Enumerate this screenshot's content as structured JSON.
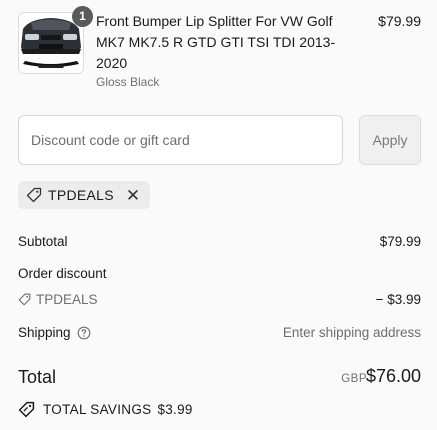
{
  "product": {
    "title": "Front Bumper Lip Splitter For VW Golf MK7 MK7.5 R GTD GTI TSI TDI 2013-2020",
    "variant": "Gloss Black",
    "price": "$79.99",
    "quantity": "1",
    "image_icon": "car-front-bumper-image"
  },
  "discount": {
    "placeholder": "Discount code or gift card",
    "value": "",
    "apply_label": "Apply",
    "applied_code": "TPDEALS",
    "remove_icon": "close-icon"
  },
  "summary": {
    "subtotal_label": "Subtotal",
    "subtotal_value": "$79.99",
    "order_discount_label": "Order discount",
    "discount_code": "TPDEALS",
    "discount_value": "− $3.99",
    "shipping_label": "Shipping",
    "shipping_value": "Enter shipping address",
    "total_label": "Total",
    "currency": "GBP",
    "total_value": "$76.00",
    "savings_label": "TOTAL SAVINGS",
    "savings_value": "$3.99"
  },
  "colors": {
    "background": "#fafafa",
    "text": "#1a1a1a",
    "muted": "#6e6e6e",
    "badge": "#5a5a5a"
  }
}
